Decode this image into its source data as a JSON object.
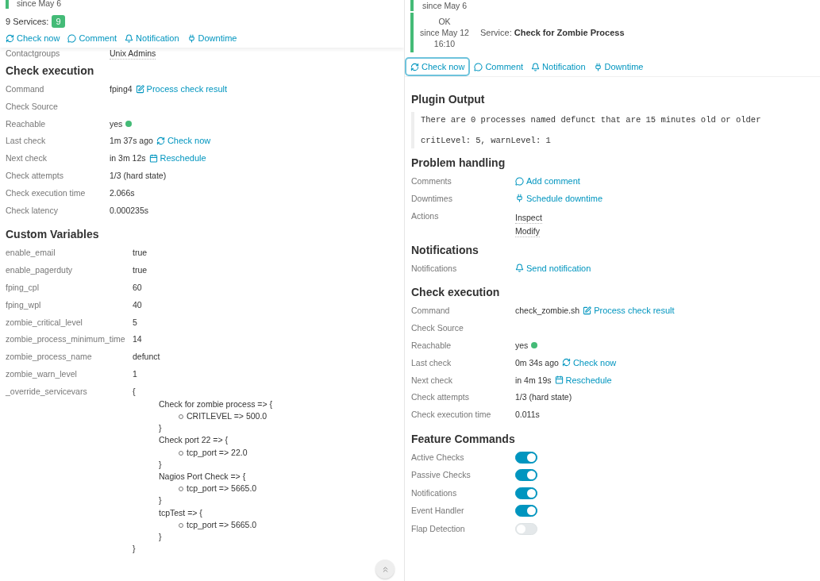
{
  "left": {
    "header": {
      "since": "since May 6",
      "services_label": "9 Services:",
      "services_count": "9"
    },
    "actions": [
      {
        "kind": "refresh",
        "label": "Check now",
        "focused": false
      },
      {
        "kind": "comment",
        "label": "Comment",
        "focused": false
      },
      {
        "kind": "bell",
        "label": "Notification",
        "focused": false
      },
      {
        "kind": "plug",
        "label": "Downtime",
        "focused": false
      }
    ],
    "top_rows": [
      {
        "label": "Contactgroups",
        "value": "Unix Admins"
      }
    ],
    "sections": [
      {
        "title": "Check execution",
        "rows": [
          {
            "label": "Command",
            "value": "fping4",
            "link": {
              "kind": "edit",
              "label": "Process check result"
            }
          },
          {
            "label": "Check Source"
          },
          {
            "label": "Reachable",
            "value": "yes"
          },
          {
            "label": "Last check",
            "value": "1m 37s ago",
            "link": {
              "kind": "refresh",
              "label": "Check now"
            }
          },
          {
            "label": "Next check",
            "value": "in 3m 12s",
            "link": {
              "kind": "calendar",
              "label": "Reschedule"
            }
          },
          {
            "label": "Check attempts",
            "value": "1/3 (hard state)"
          },
          {
            "label": "Check execution time",
            "value": "2.066s"
          },
          {
            "label": "Check latency",
            "value": "0.000235s"
          }
        ]
      },
      {
        "title": "Custom Variables",
        "rows": [
          {
            "label": "enable_email",
            "value": "true"
          },
          {
            "label": "enable_pagerduty",
            "value": "true"
          },
          {
            "label": "fping_cpl",
            "value": "60"
          },
          {
            "label": "fping_wpl",
            "value": "40"
          },
          {
            "label": "zombie_critical_level",
            "value": "5"
          },
          {
            "label": "zombie_process_minimum_time",
            "value": "14"
          },
          {
            "label": "zombie_process_name",
            "value": "defunct"
          },
          {
            "label": "zombie_warn_level",
            "value": "1"
          },
          {
            "label": "_override_servicevars",
            "value": "{",
            "close": "}",
            "tree": [
              {
                "label": "Check for zombie process => {",
                "close": "}",
                "items": [
                  "CRITLEVEL => 500.0"
                ]
              },
              {
                "label": "Check port 22 => {",
                "close": "}",
                "items": [
                  "tcp_port => 22.0"
                ]
              },
              {
                "label": "Nagios Port Check => {",
                "close": "}",
                "items": [
                  "tcp_port => 5665.0"
                ]
              },
              {
                "label": "tcpTest => {",
                "close": "}",
                "items": [
                  "tcp_port => 5665.0"
                ]
              }
            ]
          }
        ]
      }
    ]
  },
  "right": {
    "header": [
      {
        "since": "since May 6"
      },
      {
        "state": "OK",
        "since": "since May 12",
        "time": "16:10",
        "service": "Service: **Check for Zombie Process**"
      }
    ],
    "actions": [
      {
        "kind": "refresh",
        "label": "Check now",
        "focused": true
      },
      {
        "kind": "comment",
        "label": "Comment",
        "focused": false
      },
      {
        "kind": "bell",
        "label": "Notification",
        "focused": false
      },
      {
        "kind": "plug",
        "label": "Downtime",
        "focused": false
      }
    ],
    "plugin_output": {
      "title": "Plugin Output",
      "lines": [
        "There are 0 processes named defunct that are 15 minutes old or older",
        "critLevel: 5, warnLevel: 1"
      ]
    },
    "sections": [
      {
        "title": "Problem handling",
        "rows": [
          {
            "label": "Comments",
            "link": {
              "kind": "comment",
              "label": "Add comment"
            }
          },
          {
            "label": "Downtimes",
            "link": {
              "kind": "plug",
              "label": "Schedule downtime"
            }
          },
          {
            "label": "Actions",
            "values": [
              "Inspect",
              "Modify"
            ]
          }
        ]
      },
      {
        "title": "Notifications",
        "rows": [
          {
            "label": "Notifications",
            "link": {
              "kind": "bell",
              "label": "Send notification"
            }
          }
        ]
      },
      {
        "title": "Check execution",
        "rows": [
          {
            "label": "Command",
            "value": "check_zombie.sh",
            "link": {
              "kind": "edit",
              "label": "Process check result"
            }
          },
          {
            "label": "Check Source"
          },
          {
            "label": "Reachable",
            "value": "yes"
          },
          {
            "label": "Last check",
            "value": "0m 34s ago",
            "link": {
              "kind": "refresh",
              "label": "Check now"
            }
          },
          {
            "label": "Next check",
            "value": "in 4m 19s",
            "link": {
              "kind": "calendar",
              "label": "Reschedule"
            }
          },
          {
            "label": "Check attempts",
            "value": "1/3 (hard state)"
          },
          {
            "label": "Check execution time",
            "value": "0.011s"
          }
        ]
      }
    ],
    "features": {
      "title": "Feature Commands",
      "toggles": [
        {
          "label": "Active Checks",
          "on": true
        },
        {
          "label": "Passive Checks",
          "on": true
        },
        {
          "label": "Notifications",
          "on": true
        },
        {
          "label": "Event Handler",
          "on": true
        },
        {
          "label": "Flap Detection",
          "on": false
        }
      ]
    }
  }
}
